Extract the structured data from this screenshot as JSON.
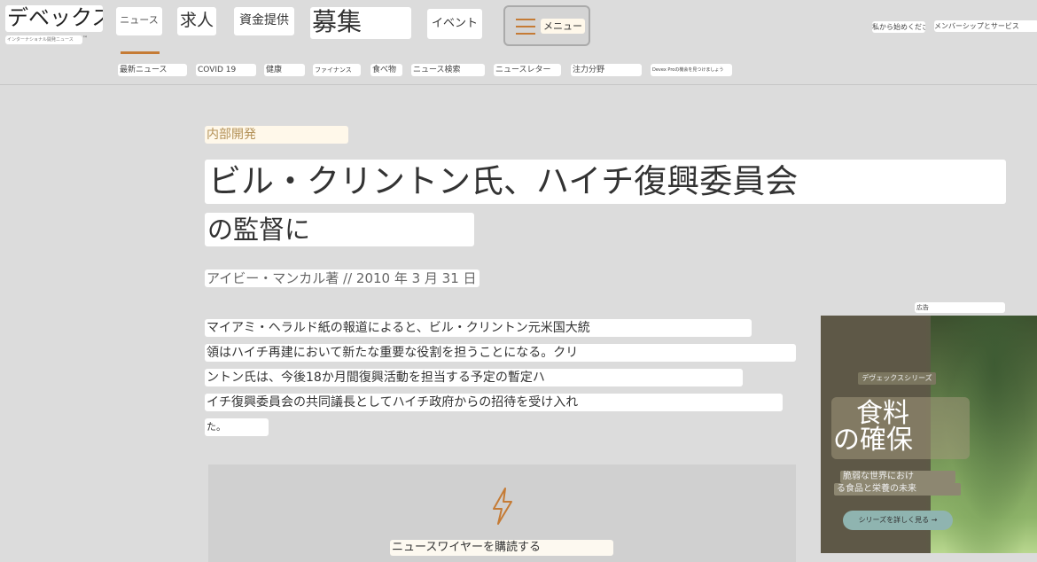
{
  "header": {
    "logo": "デベックス",
    "logo_tagline": "インターナショナル開発ニュース",
    "logo_mark": "™",
    "nav": {
      "news": "ニュース",
      "jobs": "求人",
      "funding": "資金提供",
      "recruit": "募集",
      "events": "イベント",
      "menu": "メニュー"
    },
    "login": "私から始めください",
    "membership": "メンバーシップとサービス"
  },
  "subnav": [
    "最新ニュース",
    "COVID 19",
    "健康",
    "ファイナンス",
    "食べ物",
    "ニュース検索",
    "ニュースレター",
    "注力分野",
    "Devex Proの機会を見つけましょう"
  ],
  "article": {
    "category": "内部開発",
    "title_line1": "ビル・クリントン氏、ハイチ復興委員会",
    "title_line2": "の監督に",
    "byline": "アイビー・マンカル著 // 2010 年 3 月 31 日",
    "body_lines": [
      "マイアミ・ヘラルド紙の報道によると、ビル・クリントン元米国大統",
      "領はハイチ再建において新たな重要な役割を担うことになる。クリ",
      "ントン氏は、今後18か月間復興活動を担当する予定の暫定ハ",
      "イチ復興委員会の共同議長としてハイチ政府からの招待を受け入れ",
      "た。"
    ]
  },
  "newswire": {
    "cta": "ニュースワイヤーを購読する",
    "icon": "lightning-bolt-icon",
    "accent": "#c57b35"
  },
  "ad": {
    "tag": "広告",
    "series": "デヴェックスシリーズ",
    "title_line1": "食料",
    "title_line2": "の確保",
    "desc_line1": "脆弱な世界におけ",
    "desc_line2": "る食品と栄養の未来",
    "button": "シリーズを詳しく見る →"
  },
  "colors": {
    "accent": "#c57b35",
    "background": "#dcdcdc"
  }
}
